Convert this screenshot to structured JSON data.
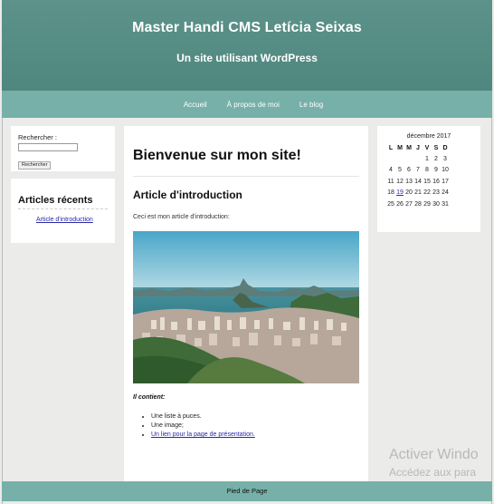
{
  "header": {
    "site_title": "Master Handi CMS Letícia Seixas",
    "tagline": "Un site utilisant WordPress"
  },
  "nav": {
    "items": [
      {
        "label": "Accueil"
      },
      {
        "label": "À propos de moi"
      },
      {
        "label": "Le blog"
      }
    ]
  },
  "search_widget": {
    "label": "Rechercher :",
    "input_value": "",
    "button_label": "Rechercher"
  },
  "recent_posts": {
    "title": "Articles récents",
    "items": [
      {
        "label": "Article d'introduction"
      }
    ]
  },
  "main": {
    "page_heading": "Bienvenue sur mon site!",
    "post_title": "Article d'introduction",
    "intro_text": "Ceci est mon article d'introduction:",
    "photo_icon": "city-bay-photo",
    "contains_label": "Il contient:",
    "bullets": [
      {
        "text": "Une liste à puces."
      },
      {
        "text": "Une image;"
      },
      {
        "text": "Un lien pour la page de présentation."
      }
    ]
  },
  "calendar": {
    "caption": "décembre 2017",
    "weekdays": [
      "L",
      "M",
      "M",
      "J",
      "V",
      "S",
      "D"
    ],
    "weeks": [
      [
        "",
        "",
        "",
        "",
        "1",
        "2",
        "3"
      ],
      [
        "4",
        "5",
        "6",
        "7",
        "8",
        "9",
        "10"
      ],
      [
        "11",
        "12",
        "13",
        "14",
        "15",
        "16",
        "17"
      ],
      [
        "18",
        "19",
        "20",
        "21",
        "22",
        "23",
        "24"
      ],
      [
        "25",
        "26",
        "27",
        "28",
        "29",
        "30",
        "31"
      ]
    ],
    "linked_day": "19"
  },
  "footer": {
    "text": "Pied de Page"
  },
  "watermark": {
    "line1": "Activer Windo",
    "line2": "Accédez aux para"
  },
  "colors": {
    "header": "#5c9289",
    "nav": "#76b0a8",
    "link": "#2a2aa8"
  }
}
